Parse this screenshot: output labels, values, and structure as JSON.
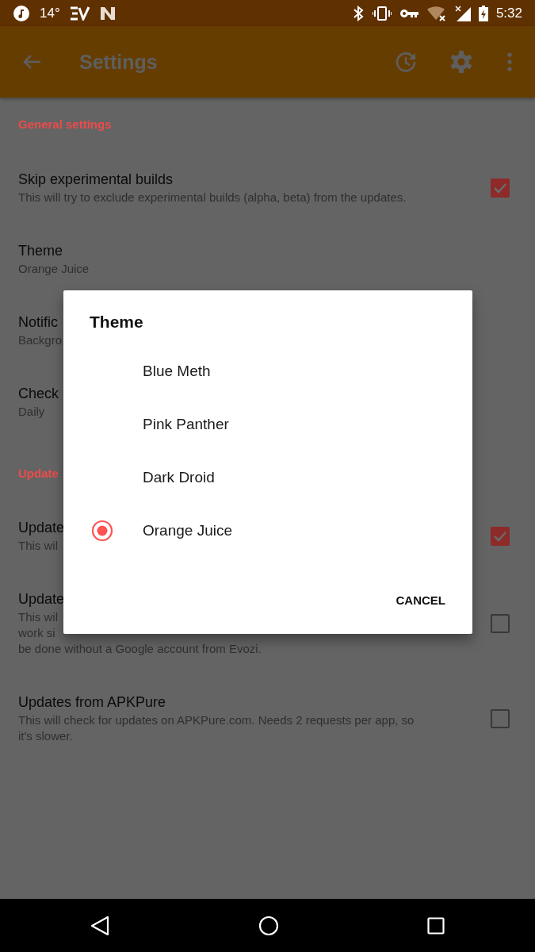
{
  "status_bar": {
    "temperature": "14°",
    "time": "5:32"
  },
  "app_bar": {
    "title": "Settings"
  },
  "settings": [
    {
      "kind": "header",
      "title": "General settings"
    },
    {
      "kind": "check",
      "title": "Skip experimental builds",
      "summary": [
        "This will try to exclude experimental builds (alpha, beta) from the updates."
      ],
      "checked": true
    },
    {
      "kind": "value",
      "title": "Theme",
      "summary": [
        "Orange Juice"
      ]
    },
    {
      "kind": "value",
      "title": "Notific",
      "summary": [
        "Backgro"
      ]
    },
    {
      "kind": "value",
      "title": "Check",
      "summary": [
        "Daily"
      ]
    },
    {
      "kind": "header",
      "title": "Update"
    },
    {
      "kind": "check",
      "title": "Update",
      "summary": [
        "This wil"
      ],
      "checked": true
    },
    {
      "kind": "check",
      "title": "Update",
      "summary": [
        "This wil",
        "work si",
        "be done without a Google account from Evozi."
      ],
      "checked": false
    },
    {
      "kind": "check",
      "title": "Updates from APKPure",
      "summary": [
        "This will check for updates on APKPure.com. Needs 2 requests per app, so",
        "it's slower."
      ],
      "checked": false
    }
  ],
  "dialog": {
    "title": "Theme",
    "options": [
      {
        "label": "Blue Meth",
        "selected": false
      },
      {
        "label": "Pink Panther",
        "selected": false
      },
      {
        "label": "Dark Droid",
        "selected": false
      },
      {
        "label": "Orange Juice",
        "selected": true
      }
    ],
    "buttons": [
      "CANCEL"
    ]
  }
}
